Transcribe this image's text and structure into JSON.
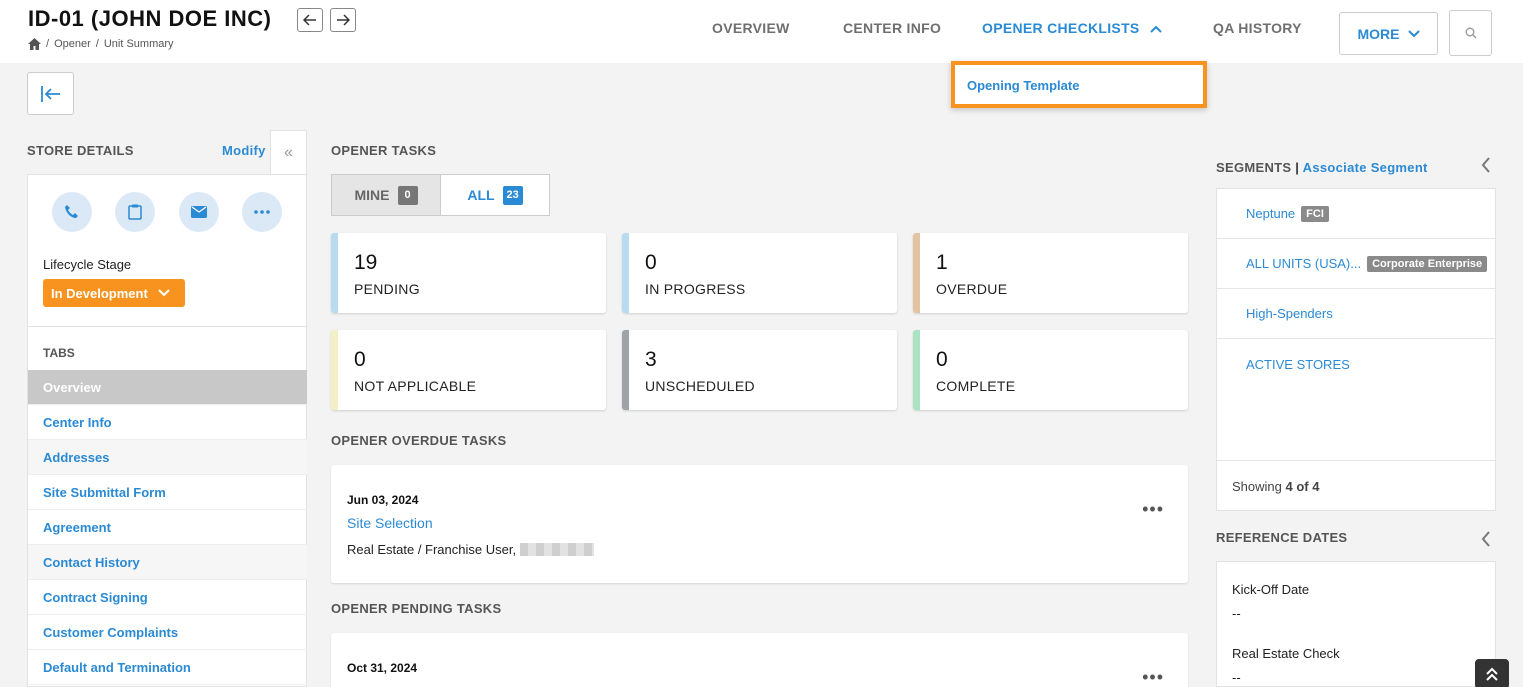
{
  "header": {
    "title": "ID-01 (JOHN DOE INC)",
    "breadcrumb": [
      "Opener",
      "Unit Summary"
    ],
    "nav": {
      "overview": "OVERVIEW",
      "center_info": "CENTER INFO",
      "opener_checklists": "OPENER CHECKLISTS",
      "qa_history": "QA HISTORY"
    },
    "more_label": "MORE"
  },
  "dropdown": {
    "item": "Opening Template"
  },
  "accent": "#2b8ad4",
  "highlight": "#f7931e",
  "store_details": {
    "title": "STORE DETAILS",
    "modify": "Modify",
    "lifecycle_label": "Lifecycle Stage",
    "lifecycle_value": "In Development",
    "tabs_label": "TABS",
    "tabs": [
      "Overview",
      "Center Info",
      "Addresses",
      "Site Submittal Form",
      "Agreement",
      "Contact History",
      "Contract Signing",
      "Customer Complaints",
      "Default and Termination"
    ]
  },
  "opener_tasks": {
    "title": "OPENER TASKS",
    "mine_label": "MINE",
    "mine_count": "0",
    "all_label": "ALL",
    "all_count": "23",
    "stats": [
      {
        "value": "19",
        "label": "PENDING",
        "color": "#b7dbf1"
      },
      {
        "value": "0",
        "label": "IN PROGRESS",
        "color": "#b7dbf1"
      },
      {
        "value": "1",
        "label": "OVERDUE",
        "color": "#e3c4a2"
      },
      {
        "value": "0",
        "label": "NOT APPLICABLE",
        "color": "#f3f1c4"
      },
      {
        "value": "3",
        "label": "UNSCHEDULED",
        "color": "#9ea3a7"
      },
      {
        "value": "0",
        "label": "COMPLETE",
        "color": "#a9e3c1"
      }
    ]
  },
  "overdue": {
    "title": "OPENER OVERDUE TASKS",
    "date": "Jun 03, 2024",
    "task": "Site Selection",
    "meta": "Real Estate / Franchise User,"
  },
  "pending": {
    "title": "OPENER PENDING TASKS",
    "date": "Oct 31, 2024"
  },
  "segments": {
    "title": "SEGMENTS",
    "associate": "Associate Segment",
    "rows": [
      {
        "name": "Neptune",
        "tag": "FCI"
      },
      {
        "name": "ALL UNITS (USA)...",
        "tag": "Corporate Enterprise"
      },
      {
        "name": "High-Spenders",
        "tag": ""
      },
      {
        "name": "ACTIVE STORES",
        "tag": ""
      }
    ],
    "showing_prefix": "Showing",
    "showing_count": "4 of 4"
  },
  "reference_dates": {
    "title": "REFERENCE DATES",
    "items": [
      {
        "label": "Kick-Off Date",
        "value": "--"
      },
      {
        "label": "Real Estate Check",
        "value": "--"
      }
    ]
  }
}
